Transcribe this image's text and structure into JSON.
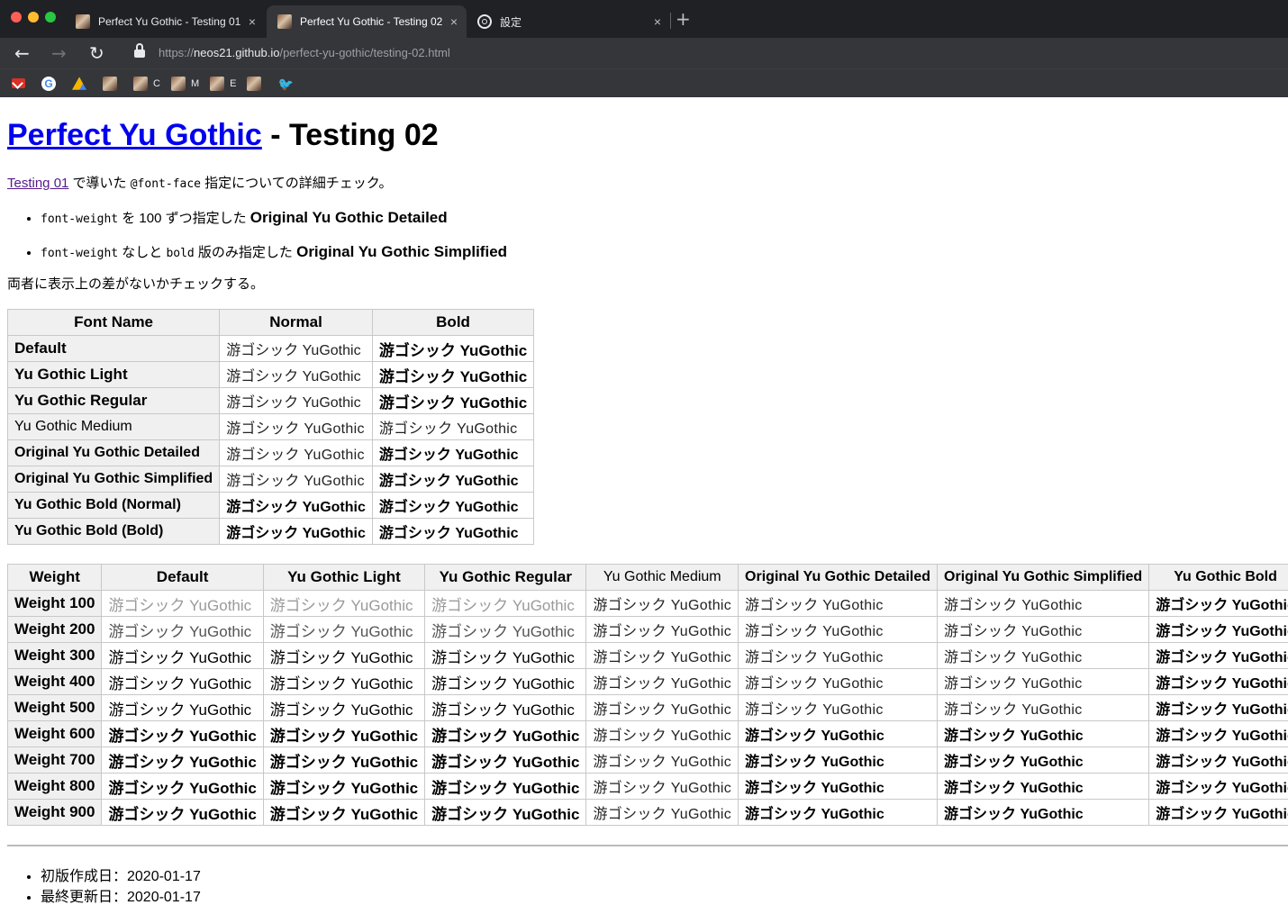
{
  "browser": {
    "tabs": [
      {
        "title": "Perfect Yu Gothic - Testing 01",
        "close": "×"
      },
      {
        "title": "Perfect Yu Gothic - Testing 02",
        "close": "×"
      },
      {
        "title": "設定",
        "close": "×"
      }
    ],
    "new_tab": "+",
    "nav": {
      "back": "←",
      "forward": "→",
      "reload": "↻"
    },
    "url_prefix": "https://",
    "url_host": "neos21.github.io",
    "url_path": "/perfect-yu-gothic/testing-02.html",
    "bookmarks": [
      {
        "icon": "gmail-icon",
        "label": ""
      },
      {
        "icon": "google-icon",
        "label": "",
        "glyph": "G"
      },
      {
        "icon": "drive-icon",
        "label": ""
      },
      {
        "icon": "site-icon",
        "label": ""
      },
      {
        "icon": "site-icon",
        "label": "C"
      },
      {
        "icon": "site-icon",
        "label": "M"
      },
      {
        "icon": "site-icon",
        "label": "E"
      },
      {
        "icon": "site-icon",
        "label": ""
      },
      {
        "icon": "twitter-icon",
        "label": "",
        "glyph": "🐦"
      }
    ]
  },
  "page": {
    "title_link": "Perfect Yu Gothic",
    "title_rest": " - Testing 02",
    "intro": {
      "link": "Testing 01",
      "before_code": " で導いた ",
      "code": "@font-face",
      "after_code": " 指定についての詳細チェック。"
    },
    "bullets": [
      {
        "code1": "font-weight",
        "mid": " を 100 ずつ指定した ",
        "bold": "Original Yu Gothic Detailed"
      },
      {
        "code1": "font-weight",
        "mid1": " なしと ",
        "code2": "bold",
        "mid2": " 版のみ指定した ",
        "bold": "Original Yu Gothic Simplified"
      }
    ],
    "note": "両者に表示上の差がないかチェックする。",
    "sample": "游ゴシック YuGothic",
    "table1": {
      "headers": [
        "Font Name",
        "Normal",
        "Bold"
      ],
      "rows": [
        {
          "name": "Default",
          "normal": "游ゴシック YuGothic",
          "bold": "游ゴシック YuGothic"
        },
        {
          "name": "Yu Gothic Light",
          "normal": "游ゴシック YuGothic",
          "bold": "游ゴシック YuGothic"
        },
        {
          "name": "Yu Gothic Regular",
          "normal": "游ゴシック YuGothic",
          "bold": "游ゴシック YuGothic"
        },
        {
          "name": "Yu Gothic Medium",
          "normal": "游ゴシック YuGothic",
          "bold": "游ゴシック YuGothic"
        },
        {
          "name": "Original Yu Gothic Detailed",
          "normal": "游ゴシック YuGothic",
          "bold": "游ゴシック YuGothic"
        },
        {
          "name": "Original Yu Gothic Simplified",
          "normal": "游ゴシック YuGothic",
          "bold": "游ゴシック YuGothic"
        },
        {
          "name": "Yu Gothic Bold (Normal)",
          "normal": "游ゴシック YuGothic",
          "bold": "游ゴシック YuGothic"
        },
        {
          "name": "Yu Gothic Bold (Bold)",
          "normal": "游ゴシック YuGothic",
          "bold": "游ゴシック YuGothic"
        }
      ]
    },
    "table2": {
      "headers": [
        "Weight",
        "Default",
        "Yu Gothic Light",
        "Yu Gothic Regular",
        "Yu Gothic Medium",
        "Original Yu Gothic Detailed",
        "Original Yu Gothic Simplified",
        "Yu Gothic Bold"
      ],
      "rows": [
        {
          "label": "Weight 100",
          "weight": 100
        },
        {
          "label": "Weight 200",
          "weight": 200
        },
        {
          "label": "Weight 300",
          "weight": 300
        },
        {
          "label": "Weight 400",
          "weight": 400
        },
        {
          "label": "Weight 500",
          "weight": 500
        },
        {
          "label": "Weight 600",
          "weight": 600
        },
        {
          "label": "Weight 700",
          "weight": 700
        },
        {
          "label": "Weight 800",
          "weight": 800
        },
        {
          "label": "Weight 900",
          "weight": 900
        }
      ]
    },
    "meta": [
      "初版作成日：2020-01-17",
      "最終更新日：2020-01-17"
    ]
  }
}
